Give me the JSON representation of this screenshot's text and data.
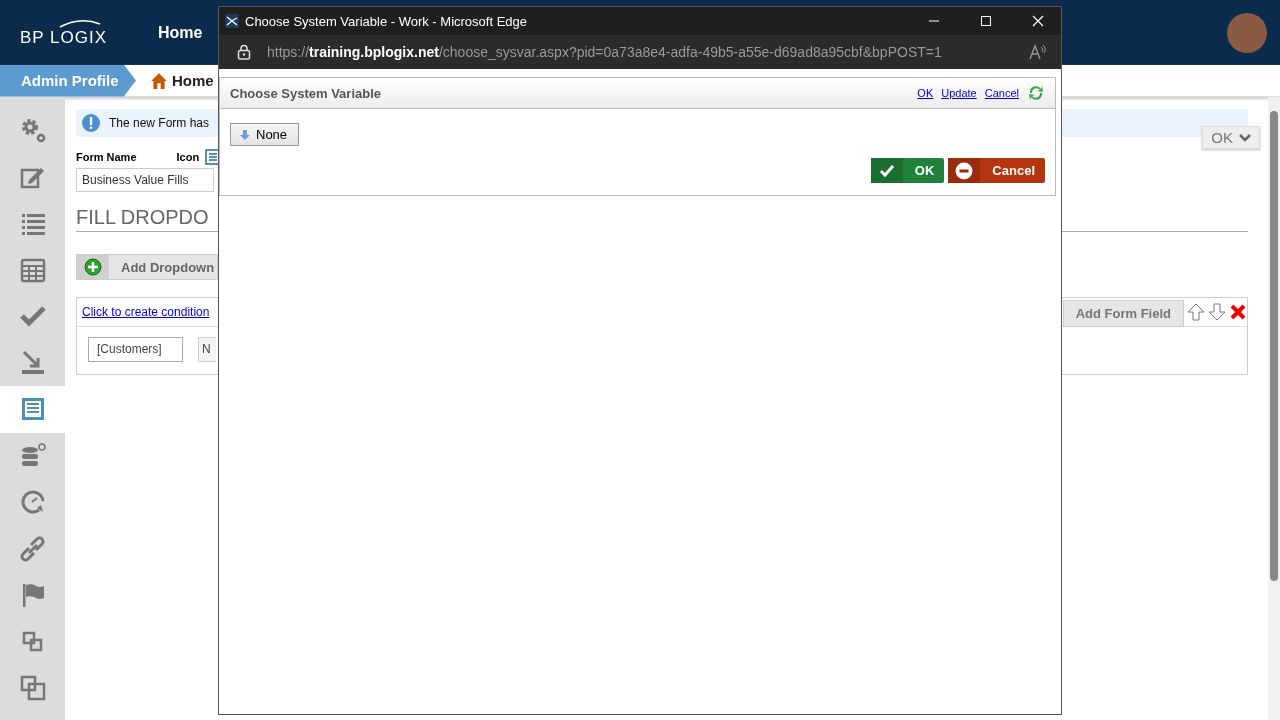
{
  "app_header": {
    "logo": "BP LOGIX",
    "nav": [
      {
        "label": "Home"
      }
    ]
  },
  "breadcrumb": [
    {
      "label": "Admin Profile",
      "kind": "profile"
    },
    {
      "label": "Home",
      "kind": "home"
    }
  ],
  "sidebar": {
    "items": [
      {
        "selected": false
      },
      {
        "selected": false
      },
      {
        "selected": false
      },
      {
        "selected": false
      },
      {
        "selected": false
      },
      {
        "selected": false
      },
      {
        "selected": true
      },
      {
        "selected": false
      },
      {
        "selected": false
      },
      {
        "selected": false
      },
      {
        "selected": false
      },
      {
        "selected": false
      },
      {
        "selected": false
      }
    ]
  },
  "notice": {
    "text": "The new Form has"
  },
  "form": {
    "name_label": "Form Name",
    "icon_label": "Icon",
    "name_value": "Business Value Fills"
  },
  "ok_menu": {
    "label": "OK"
  },
  "section_title": "FILL DROPDO",
  "add_dropdown_button": "Add Dropdown",
  "condition_panel": {
    "link": "Click to create condition",
    "add_field_button": "Add Form Field",
    "fields": [
      {
        "value": "[Customers]"
      },
      {
        "value": "N"
      }
    ]
  },
  "popup": {
    "window_title": "Choose System Variable - Work - Microsoft Edge",
    "url": {
      "scheme": "https://",
      "domain": "training.bplogix.net",
      "path": "/choose_sysvar.aspx?pid=0a73a8e4-adfa-49b5-a55e-d69ad8a95cbf&bpPOST=1"
    },
    "dialog_title": "Choose System Variable",
    "links": [
      "OK",
      "Update",
      "Cancel"
    ],
    "none_button": "None",
    "ok_button": "OK",
    "cancel_button": "Cancel"
  }
}
